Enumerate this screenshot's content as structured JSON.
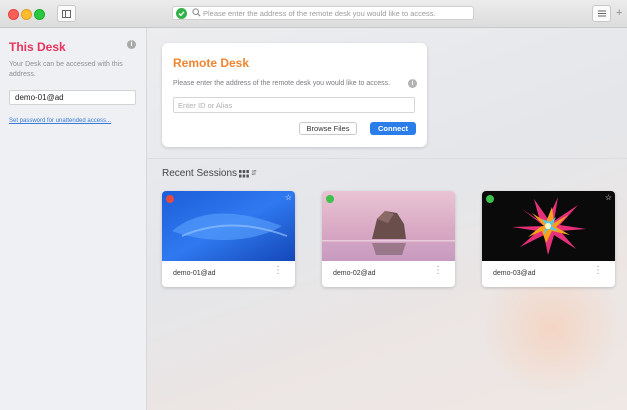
{
  "toolbar": {
    "address_placeholder": "Please enter the address of the remote desk you would like to access."
  },
  "sidebar": {
    "title": "This Desk",
    "description": "Your Desk can be accessed with this address.",
    "desk_id": "demo-01@ad",
    "password_link": "Set password for unattended access..."
  },
  "remote_desk": {
    "title": "Remote Desk",
    "description": "Please enter the address of the remote desk you would like to access.",
    "input_placeholder": "Enter ID or Alias",
    "browse_label": "Browse Files",
    "connect_label": "Connect"
  },
  "recent": {
    "title": "Recent Sessions",
    "sessions": [
      {
        "name": "demo-01@ad",
        "status": "offline",
        "status_color": "#e8493c",
        "thumbnail": "blue-wallpaper"
      },
      {
        "name": "demo-02@ad",
        "status": "online",
        "status_color": "#3cc24c",
        "thumbnail": "rock-in-lake"
      },
      {
        "name": "demo-03@ad",
        "status": "online",
        "status_color": "#3cc24c",
        "thumbnail": "color-explosion"
      }
    ]
  },
  "colors": {
    "sidebar_title": "#e5355d",
    "remote_title": "#f08531",
    "connect_button": "#2b7de9"
  }
}
